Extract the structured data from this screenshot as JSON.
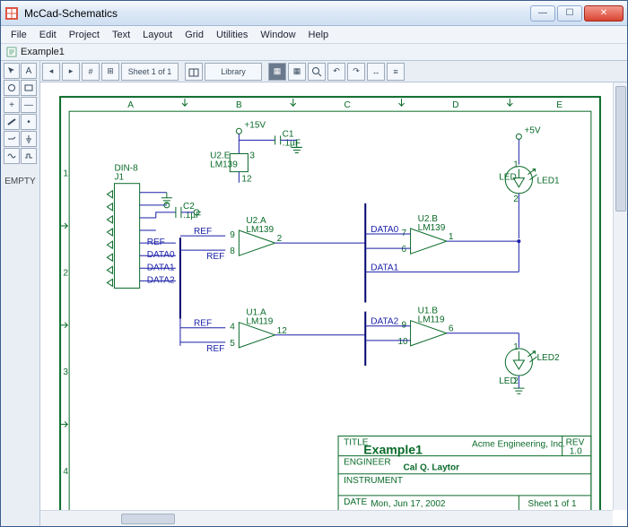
{
  "window": {
    "title": "McCad-Schematics"
  },
  "menubar": [
    "File",
    "Edit",
    "Project",
    "Text",
    "Layout",
    "Grid",
    "Utilities",
    "Window",
    "Help"
  ],
  "document": {
    "name": "Example1"
  },
  "toolstrip": {
    "sheet_indicator": "Sheet 1 of 1",
    "library_label": "Library"
  },
  "toolbox": {
    "empty_label": "EMPTY"
  },
  "sheet": {
    "columns": [
      "A",
      "B",
      "C",
      "D",
      "E"
    ],
    "rows": [
      "1",
      "2",
      "3",
      "4"
    ],
    "power": {
      "top_left": "+15V",
      "top_right": "+5V"
    },
    "caps": {
      "c1": {
        "ref": "C1",
        "val": ".1µF"
      },
      "c2": {
        "ref": "C2",
        "val": ".1µF"
      }
    },
    "connector": {
      "ref": "DIN-8",
      "des": "J1",
      "labels": [
        "REF",
        "DATA0",
        "DATA1",
        "DATA2"
      ]
    },
    "amps": {
      "u2e": {
        "ref": "U2.E",
        "type": "LM139",
        "pins": {
          "out": "3",
          "neg": "12"
        }
      },
      "u2a": {
        "ref": "U2.A",
        "type": "LM139",
        "pins": {
          "pos": "9",
          "neg": "8",
          "out": "2",
          "posnet": "REF",
          "negnet": "REF"
        }
      },
      "u2b": {
        "ref": "U2.B",
        "type": "LM139",
        "pins": {
          "pos": "7",
          "neg": "6",
          "out": "1",
          "posnet": "DATA0"
        }
      },
      "u1a": {
        "ref": "U1.A",
        "type": "LM119",
        "pins": {
          "pos": "4",
          "neg": "5",
          "out": "12",
          "posnet": "REF",
          "negnet": "REF"
        }
      },
      "u1b": {
        "ref": "U1.B",
        "type": "LM119",
        "pins": {
          "pos": "9",
          "neg": "10",
          "out": "6",
          "posnet": "DATA2"
        }
      }
    },
    "nets": {
      "data0": "DATA0",
      "data1": "DATA1",
      "data2": "DATA2"
    },
    "leds": {
      "led1": {
        "ref": "LED",
        "des": "LED1",
        "p1": "1",
        "p2": "2"
      },
      "led2": {
        "ref": "LED",
        "des": "LED2",
        "p1": "1",
        "p2": "2"
      }
    },
    "titleblock": {
      "title_label": "TITLE",
      "title": "Example1",
      "company": "Acme Engineering, Inc.",
      "rev_label": "REV",
      "rev": "1.0",
      "engineer_label": "ENGINEER",
      "engineer": "Cal Q. Laytor",
      "instrument_label": "INSTRUMENT",
      "date_label": "DATE",
      "date": "Mon, Jun 17, 2002",
      "sheet": "Sheet 1 of 1"
    }
  }
}
